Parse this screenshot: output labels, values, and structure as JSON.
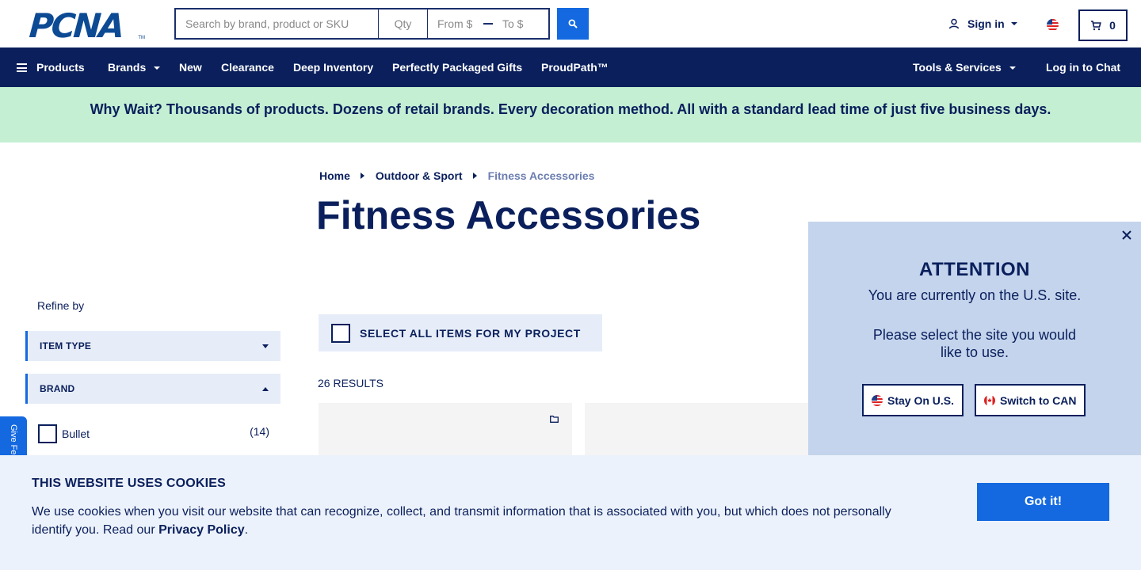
{
  "header": {
    "logo_text": "PCNA",
    "logo_tm": "TM",
    "search_placeholder": "Search by brand, product or SKU",
    "qty_placeholder": "Qty",
    "from_placeholder": "From $",
    "to_placeholder": "To $",
    "signin_label": "Sign in",
    "cart_count": "0"
  },
  "nav": {
    "products": "Products",
    "brands": "Brands",
    "new": "New",
    "clearance": "Clearance",
    "deep_inventory": "Deep Inventory",
    "gifts": "Perfectly Packaged Gifts",
    "proudpath": "ProudPath™",
    "tools": "Tools & Services",
    "chat": "Log in to Chat"
  },
  "promo": {
    "text": "Why Wait? Thousands of products. Dozens of retail brands. Every decoration method. All with a standard lead time of just five business days."
  },
  "breadcrumb": {
    "home": "Home",
    "category": "Outdoor & Sport",
    "current": "Fitness Accessories"
  },
  "page_title": "Fitness Accessories",
  "sidebar": {
    "refine_label": "Refine by",
    "facets": [
      {
        "label": "ITEM TYPE",
        "expanded": false
      },
      {
        "label": "BRAND",
        "expanded": true
      }
    ],
    "brands": [
      {
        "label": "Bullet",
        "count": "(14)"
      }
    ]
  },
  "feedback_label": "Give Feedback",
  "main": {
    "select_all_label": "SELECT ALL ITEMS FOR MY PROJECT",
    "results_label": "26 RESULTS"
  },
  "popup": {
    "title": "ATTENTION",
    "line1": "You are currently on the U.S. site.",
    "line2": "Please select the site you would like to use.",
    "stay_label": "Stay On U.S.",
    "switch_label": "Switch to CAN"
  },
  "cookie": {
    "title": "THIS WEBSITE USES COOKIES",
    "text": "We use cookies when you visit our website that can recognize, collect, and transmit information that is associated with you, but which does not personally identify you. Read our ",
    "link": "Privacy Policy",
    "period": ".",
    "button": "Got it!"
  },
  "colors": {
    "navy": "#0a1f5c",
    "accent_blue": "#1469e0",
    "promo_green": "#c4efd3",
    "popup_bg": "#c4d4ec",
    "cookie_bg": "#ecf2fb"
  }
}
